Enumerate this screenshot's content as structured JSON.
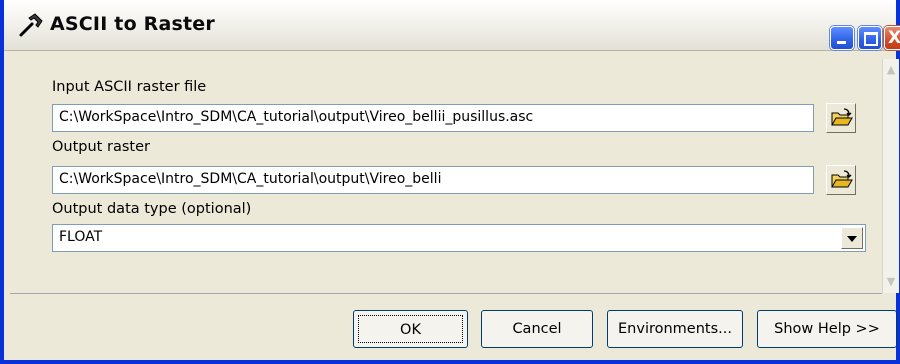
{
  "window": {
    "title": "ASCII to Raster",
    "icon": "hammer-icon",
    "controls": [
      "minimize-icon",
      "maximize-icon",
      "close-icon"
    ],
    "close_glyph": "X"
  },
  "form": {
    "input_label": "Input ASCII raster file",
    "input_value": "C:\\WorkSpace\\Intro_SDM\\CA_tutorial\\output\\Vireo_bellii_pusillus.asc",
    "output_label": "Output raster",
    "output_value": "C:\\WorkSpace\\Intro_SDM\\CA_tutorial\\output\\Vireo_belli",
    "type_label": "Output data type (optional)",
    "type_value": "FLOAT",
    "browse_icon": "open-folder-icon"
  },
  "buttons": {
    "ok": "OK",
    "cancel": "Cancel",
    "environments": "Environments...",
    "show_help": "Show Help >>"
  },
  "colors": {
    "window_border": "#0831d9",
    "dialog_bg": "#ece9d8",
    "title_button_blue": "#2e62e8",
    "close_button_red": "#d44d28"
  }
}
